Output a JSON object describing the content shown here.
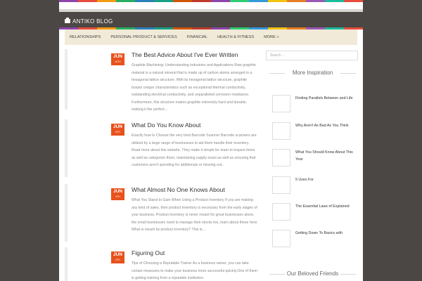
{
  "colors": {
    "stripe": [
      "#8e44ad",
      "#e74c3c",
      "#f39c12",
      "#27ae60",
      "#2980b9",
      "#16a085",
      "#d35400",
      "#c0392b",
      "#8e44ad",
      "#2ecc71",
      "#3498db",
      "#f1c40f",
      "#e67e22",
      "#9b59b6",
      "#1abc9c",
      "#e74c3c"
    ],
    "accent": "#e8511c"
  },
  "header": {
    "brand": "ANTIKO BLOG",
    "brand_icon": "briefcase-icon"
  },
  "nav": {
    "items": [
      {
        "label": "RELATIONSHIPS"
      },
      {
        "label": "PERSONAL PRODUCT & SERVICES"
      },
      {
        "label": "FINANCIAL"
      },
      {
        "label": "HEALTH & FITNESS"
      },
      {
        "label": "MORE »"
      }
    ]
  },
  "posts": [
    {
      "month": "JUN",
      "day": "14TH",
      "title": "The Best Advice About I've Ever Written",
      "excerpt": "Graphite Machining: Understanding Industries and Applications Raw graphite material is a natural mineral that is made up of carbon atoms arranged in a hexagonal lattice structure. With its hexagonal lattice structure, graphite boasts unique characteristics such as exceptional thermal conductivity, outstanding electrical conductivity, and unparalleled corrosion resistance. Furthermore, this structure makes graphite extremely hard and durable, making it the perfect..."
    },
    {
      "month": "JUN",
      "day": "6TH",
      "title": "What Do You Know About",
      "excerpt": "Exactly how to Choose the very best Barcode Scanner Barcode scanners are utilized by a large range of businesses to aid them handle their inventory. Read more about this website. They make it simple for team to inspect items as well as categorize them, maintaining supply exact as well as ensuring that customers aren't spending for additionals or missing out..."
    },
    {
      "month": "JUN",
      "day": "4TH",
      "title": "What Almost No One Knows About",
      "excerpt": "What You Stand to Gain When Using a Product Inventory If you are making any kind of sales, then product inventory is necessary from the early stages of your business. Product inventory is never meant for great businesses alone, the small businesses need to manage their stocks too, learn about these here. What is meant by product inventory? This is..."
    },
    {
      "month": "JUN",
      "day": "4TH",
      "title": "Figuring Out",
      "excerpt": "Tips of Choosing a Reputable Trainer As a business owner, you can take certain measures to make your business more successful quickly.One of them is getting training from a reputable institution."
    }
  ],
  "sidebar": {
    "search_placeholder": "Search ...",
    "inspiration_title": "More Inspiration",
    "inspiration": [
      {
        "label": "Finding Parallels Between and Life"
      },
      {
        "label": "Why Aren't As Bad As You Think"
      },
      {
        "label": "What You Should Know About This Year"
      },
      {
        "label": "5 Uses For"
      },
      {
        "label": "The Essential Laws of Explained"
      },
      {
        "label": "Getting Down To Basics with"
      }
    ],
    "friends_title": "Our Beloved Friends"
  }
}
